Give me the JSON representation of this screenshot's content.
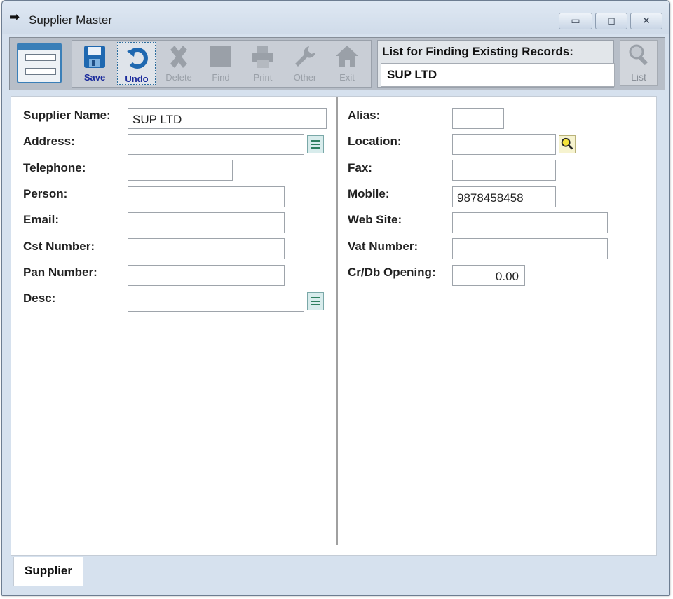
{
  "window": {
    "title": "Supplier Master"
  },
  "toolbar": {
    "buttons": [
      {
        "label": "Save",
        "enabled": true
      },
      {
        "label": "Undo",
        "enabled": true
      },
      {
        "label": "Delete",
        "enabled": false
      },
      {
        "label": "Find",
        "enabled": false
      },
      {
        "label": "Print",
        "enabled": false
      },
      {
        "label": "Other",
        "enabled": false
      },
      {
        "label": "Exit",
        "enabled": false
      }
    ],
    "finder_label": "List for Finding Existing Records:",
    "finder_value": "SUP LTD",
    "list_label": "List"
  },
  "form": {
    "left": [
      {
        "label": "Supplier Name:",
        "value": "SUP LTD"
      },
      {
        "label": "Address:",
        "value": ""
      },
      {
        "label": "Telephone:",
        "value": ""
      },
      {
        "label": "Person:",
        "value": ""
      },
      {
        "label": "Email:",
        "value": ""
      },
      {
        "label": "Cst Number:",
        "value": ""
      },
      {
        "label": "Pan Number:",
        "value": ""
      },
      {
        "label": "Desc:",
        "value": ""
      }
    ],
    "right": [
      {
        "label": "Alias:",
        "value": ""
      },
      {
        "label": "Location:",
        "value": ""
      },
      {
        "label": "Fax:",
        "value": ""
      },
      {
        "label": "Mobile:",
        "value": "9878458458"
      },
      {
        "label": "Web Site:",
        "value": ""
      },
      {
        "label": "Vat Number:",
        "value": ""
      },
      {
        "label": "Cr/Db Opening:",
        "value": "0.00"
      }
    ]
  },
  "tabs": {
    "active": "Supplier"
  },
  "colors": {
    "accent": "#1a2a9c",
    "window_bg": "#d6e1ee",
    "toolbar_bg": "#b7bec8"
  }
}
